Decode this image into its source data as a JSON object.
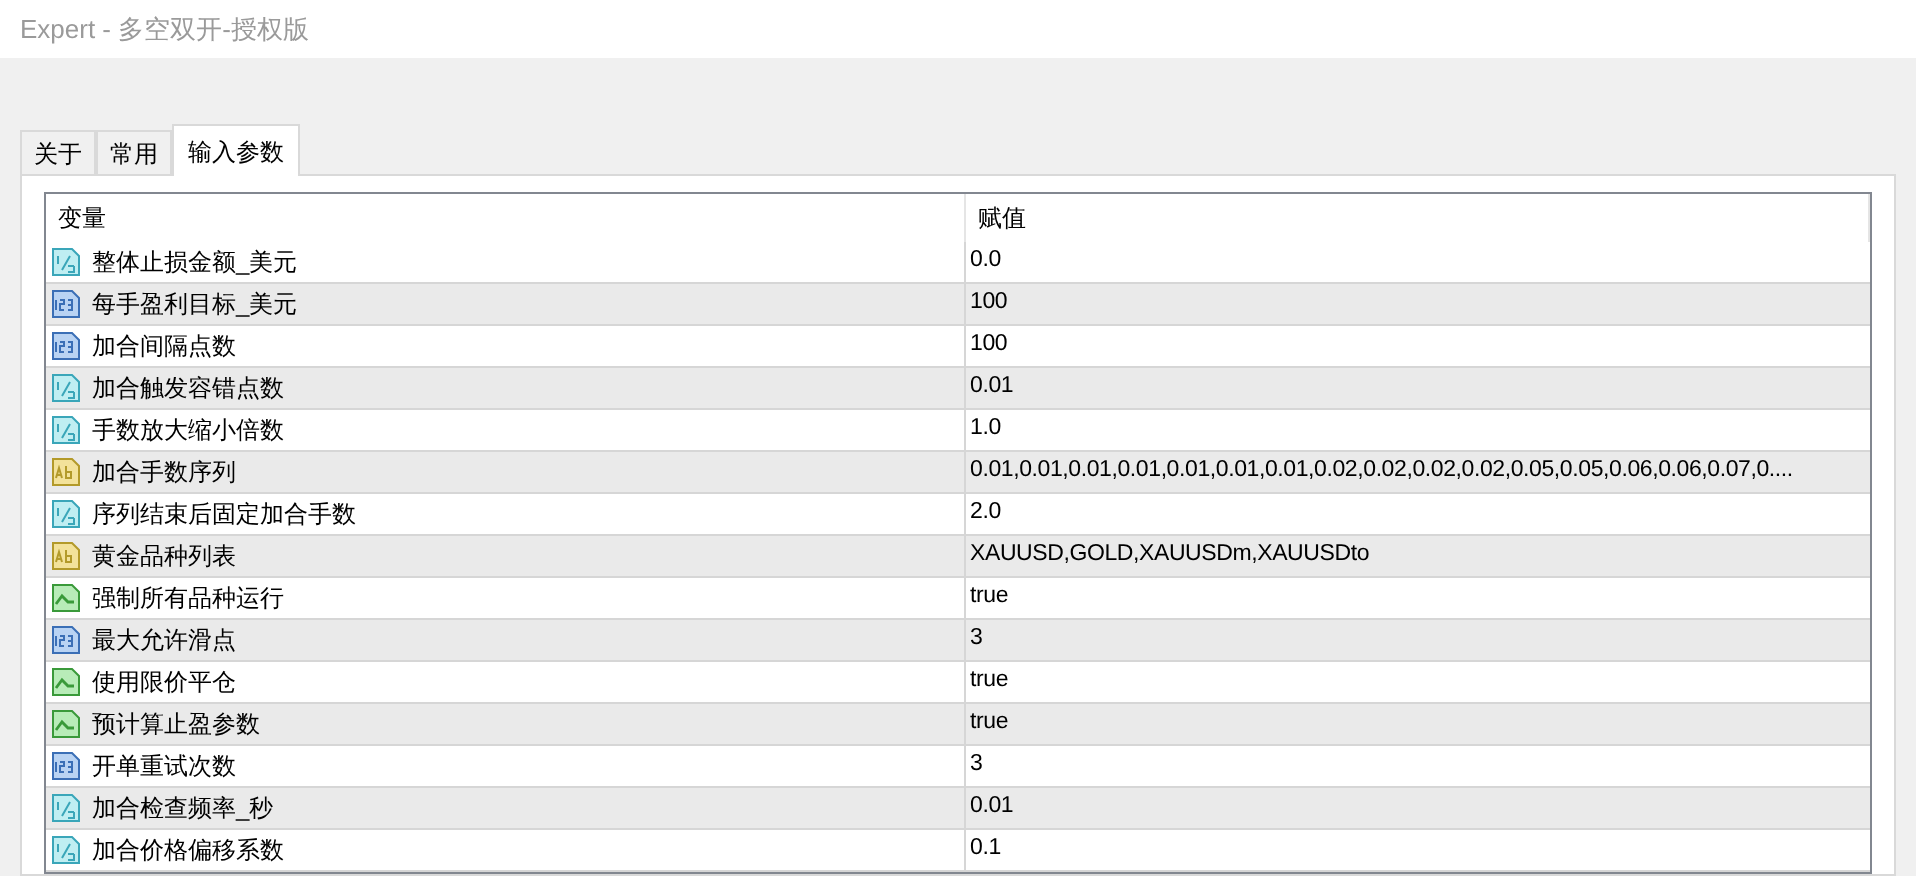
{
  "window": {
    "title": "Expert - 多空双开-授权版"
  },
  "tabs": [
    {
      "label": "关于",
      "selected": false
    },
    {
      "label": "常用",
      "selected": false
    },
    {
      "label": "输入参数",
      "selected": true
    }
  ],
  "table": {
    "columns": [
      "变量",
      "赋值"
    ],
    "rows": [
      {
        "kind": "double",
        "name": "整体止损金额_美元",
        "value": "0.0"
      },
      {
        "kind": "int",
        "name": "每手盈利目标_美元",
        "value": "100"
      },
      {
        "kind": "int",
        "name": "加合间隔点数",
        "value": "100"
      },
      {
        "kind": "double",
        "name": "加合触发容错点数",
        "value": "0.01"
      },
      {
        "kind": "double",
        "name": "手数放大缩小倍数",
        "value": "1.0"
      },
      {
        "kind": "string",
        "name": "加合手数序列",
        "value": "0.01,0.01,0.01,0.01,0.01,0.01,0.01,0.02,0.02,0.02,0.02,0.05,0.05,0.06,0.06,0.07,0...."
      },
      {
        "kind": "double",
        "name": "序列结束后固定加合手数",
        "value": "2.0"
      },
      {
        "kind": "string",
        "name": "黄金品种列表",
        "value": "XAUUSD,GOLD,XAUUSDm,XAUUSDto"
      },
      {
        "kind": "bool",
        "name": "强制所有品种运行",
        "value": "true"
      },
      {
        "kind": "int",
        "name": "最大允许滑点",
        "value": "3"
      },
      {
        "kind": "bool",
        "name": "使用限价平仓",
        "value": "true"
      },
      {
        "kind": "bool",
        "name": "预计算止盈参数",
        "value": "true"
      },
      {
        "kind": "int",
        "name": "开单重试次数",
        "value": "3"
      },
      {
        "kind": "double",
        "name": "加合检查频率_秒",
        "value": "0.01"
      },
      {
        "kind": "double",
        "name": "加合价格偏移系数",
        "value": "0.1"
      }
    ]
  }
}
